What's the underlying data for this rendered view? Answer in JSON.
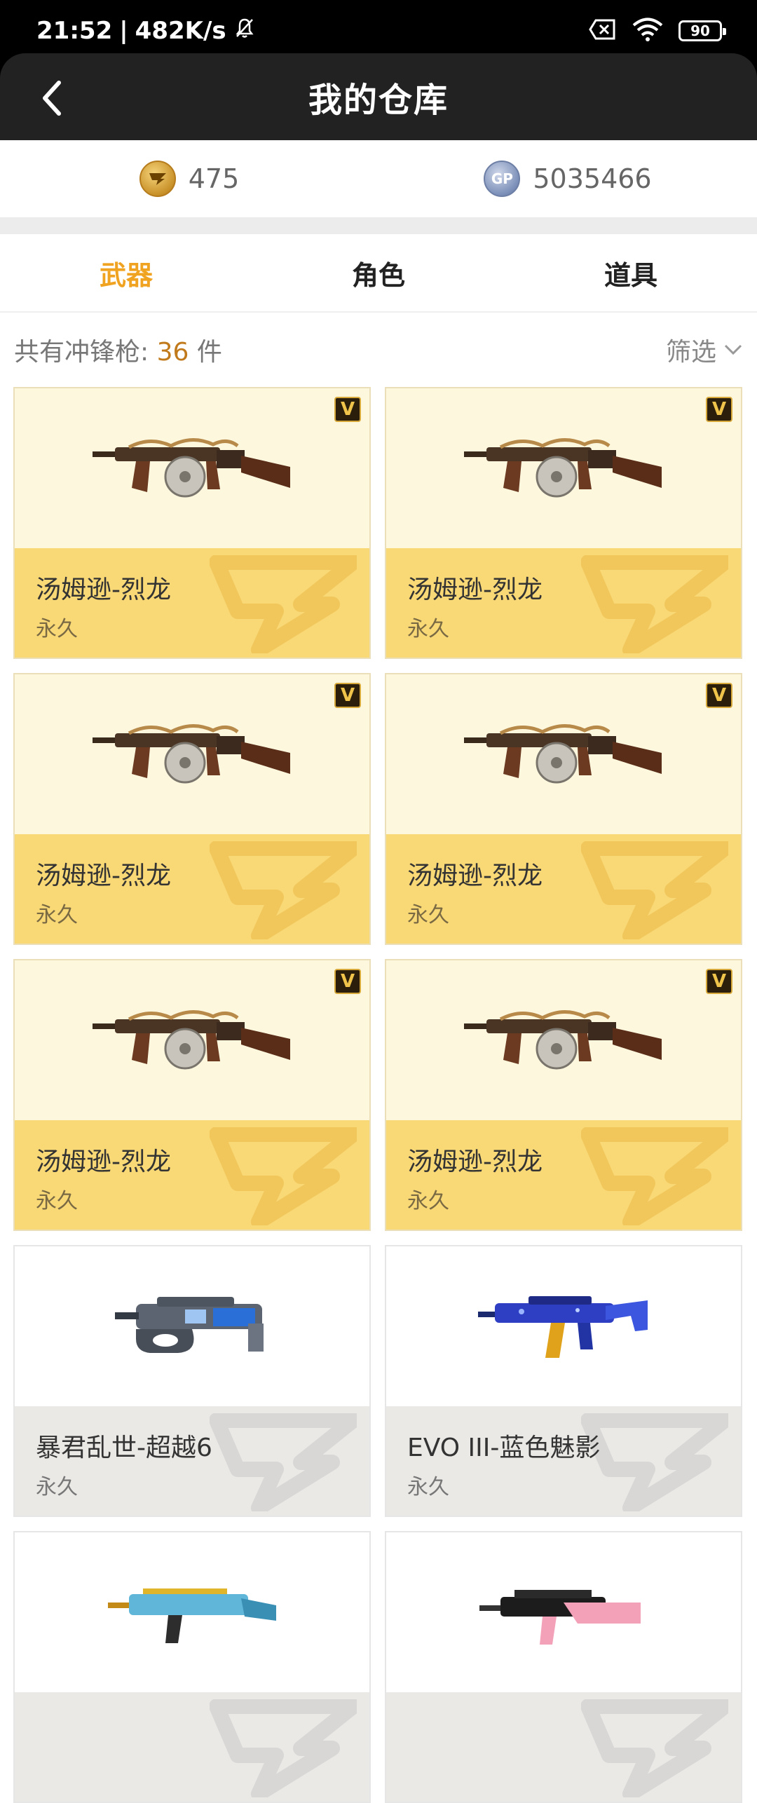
{
  "status_bar": {
    "time": "21:52",
    "speed": "482K/s",
    "battery": "90"
  },
  "header": {
    "title": "我的仓库"
  },
  "currency": {
    "cf_points": "475",
    "gp_points": "5035466",
    "cf_icon": "cf-coin-icon",
    "gp_icon": "gp-coin-icon",
    "gp_label": "GP"
  },
  "tabs": [
    {
      "label": "武器",
      "active": true
    },
    {
      "label": "角色",
      "active": false
    },
    {
      "label": "道具",
      "active": false
    }
  ],
  "summary": {
    "prefix": "共有冲锋枪:",
    "count": "36",
    "unit": "件",
    "filter_label": "筛选"
  },
  "items": [
    {
      "name": "汤姆逊-烈龙",
      "duration": "永久",
      "badge": "V",
      "rarity": "gold",
      "weapon": "thompson"
    },
    {
      "name": "汤姆逊-烈龙",
      "duration": "永久",
      "badge": "V",
      "rarity": "gold",
      "weapon": "thompson"
    },
    {
      "name": "汤姆逊-烈龙",
      "duration": "永久",
      "badge": "V",
      "rarity": "gold",
      "weapon": "thompson"
    },
    {
      "name": "汤姆逊-烈龙",
      "duration": "永久",
      "badge": "V",
      "rarity": "gold",
      "weapon": "thompson"
    },
    {
      "name": "汤姆逊-烈龙",
      "duration": "永久",
      "badge": "V",
      "rarity": "gold",
      "weapon": "thompson"
    },
    {
      "name": "汤姆逊-烈龙",
      "duration": "永久",
      "badge": "V",
      "rarity": "gold",
      "weapon": "thompson"
    },
    {
      "name": "暴君乱世-超越6",
      "duration": "永久",
      "badge": "",
      "rarity": "gray",
      "weapon": "p90"
    },
    {
      "name": "EVO III-蓝色魅影",
      "duration": "永久",
      "badge": "",
      "rarity": "gray",
      "weapon": "evo"
    },
    {
      "name": "",
      "duration": "",
      "badge": "",
      "rarity": "gray",
      "weapon": "ump"
    },
    {
      "name": "",
      "duration": "",
      "badge": "",
      "rarity": "gray",
      "weapon": "mp7"
    }
  ],
  "colors": {
    "accent": "#f0a321",
    "gold_card": "#f9d876",
    "gold_card_top": "#fdf7de",
    "header": "#222222"
  }
}
